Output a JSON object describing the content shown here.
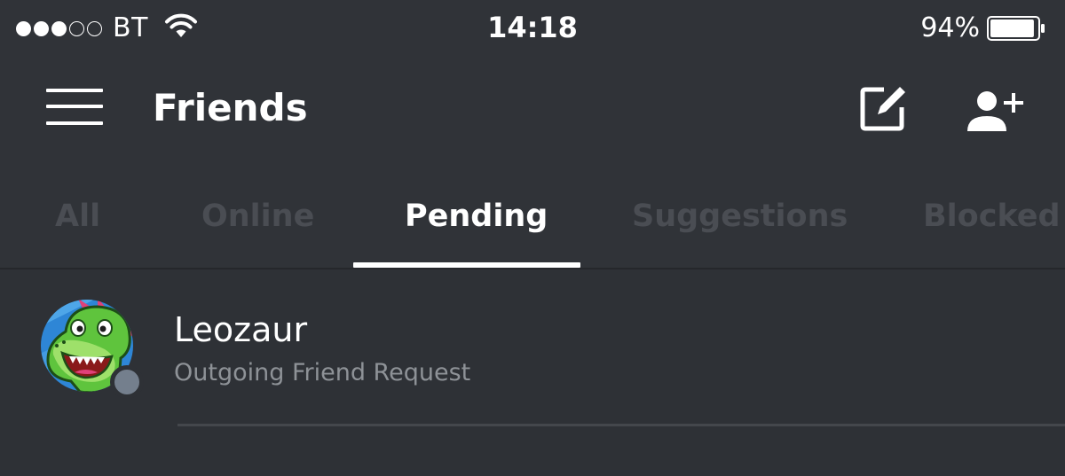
{
  "status_bar": {
    "signal_filled": 3,
    "signal_total": 5,
    "carrier": "BT",
    "time": "14:18",
    "battery_percent_text": "94%",
    "battery_level": 0.94,
    "icons": [
      "wifi-icon",
      "battery-icon"
    ]
  },
  "header": {
    "title": "Friends",
    "icons": [
      "hamburger-menu-icon",
      "compose-icon",
      "add-friend-icon"
    ]
  },
  "tabs": [
    {
      "label": "All",
      "active": false
    },
    {
      "label": "Online",
      "active": false
    },
    {
      "label": "Pending",
      "active": true
    },
    {
      "label": "Suggestions",
      "active": false
    },
    {
      "label": "Blocked",
      "active": false
    }
  ],
  "friends": [
    {
      "username": "Leozaur",
      "subtitle": "Outgoing Friend Request",
      "presence": "offline",
      "avatar_icon": "dinosaur-avatar"
    }
  ],
  "colors": {
    "background": "#2e3136",
    "header_background": "#303338",
    "text_primary": "#ffffff",
    "text_muted": "#8e9297",
    "tab_inactive": "#4a4d53",
    "presence_offline": "#747f8d"
  }
}
